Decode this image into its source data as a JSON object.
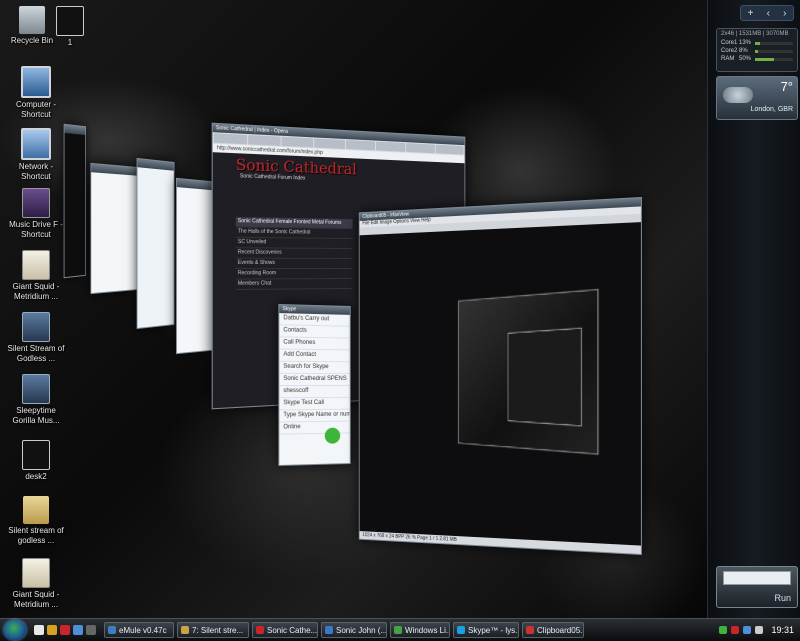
{
  "desktop": {
    "icons": [
      {
        "label": "Recycle Bin"
      },
      {
        "label": "1"
      },
      {
        "label": "Computer - Shortcut"
      },
      {
        "label": "Network - Shortcut"
      },
      {
        "label": "Music Drive F - Shortcut"
      },
      {
        "label": "Giant Squid - Metridium ..."
      },
      {
        "label": "Silent Stream of Godless ..."
      },
      {
        "label": "Sleepytime Gorilla Mus..."
      },
      {
        "label": "desk2"
      },
      {
        "label": "Silent stream of godless ..."
      },
      {
        "label": "Giant Squid - Metridium ..."
      }
    ]
  },
  "sidebar": {
    "top_buttons": [
      "+",
      "‹",
      "›"
    ],
    "cpu": {
      "title": "2x46 | 1531MB | 3070MB",
      "rows": [
        {
          "name": "Core1",
          "value": "13%",
          "level": 0.13
        },
        {
          "name": "Core2",
          "value": "8%",
          "level": 0.08
        },
        {
          "name": "RAM",
          "value": "50%",
          "level": 0.5
        }
      ]
    },
    "weather": {
      "temp": "7°",
      "location": "London, GBR"
    },
    "run": {
      "label": "Run"
    }
  },
  "windows": {
    "opera": {
      "title": "Sonic Cathedral | Index - Opera",
      "address": "http://www.soniccathedral.com/forum/index.php",
      "logo": "Sonic Cathedral",
      "subtitle": "Sonic Cathedral Forum Index",
      "rows": [
        "Sonic Cathedral Female Fronted Metal Forums",
        "The Halls of the Sonic Cathedral",
        "SC Unveiled",
        "Recent Discoveries",
        "Events & Shows",
        "Recording Room",
        "Members Chat"
      ]
    },
    "skype": {
      "title": "Skype",
      "rows": [
        "Datbu's Carry out",
        "Contacts",
        "Call Phones",
        "Add Contact",
        "Search for Skype",
        "Sonic Cathedral SPENS",
        "shesscoff",
        "Skype Test Call",
        "Type Skype Name or number",
        "Online"
      ]
    },
    "irfan": {
      "title": "Clipboard05 - IrfanView",
      "menu": "File Edit Image Options View Help",
      "status": "1024 x 768 x 24 BPP   26 %   Page 1 / 1   2.81 MB"
    },
    "explorer_title": "",
    "mail_title": "",
    "messenger_title": "",
    "aol_title": ""
  },
  "taskbar": {
    "tasks": [
      {
        "label": "eMule v0.47c",
        "color": "#3f7fbf"
      },
      {
        "label": "7: Silent stre...",
        "color": "#caa24a"
      },
      {
        "label": "Sonic Cathe...",
        "color": "#c8262a"
      },
      {
        "label": "Sonic John (...",
        "color": "#3a78c8"
      },
      {
        "label": "Windows Li...",
        "color": "#45a24a"
      },
      {
        "label": "Skype™ - lys...",
        "color": "#1aa0e0"
      },
      {
        "label": "Clipboard05...",
        "color": "#c83232"
      }
    ],
    "clock": "19:31"
  }
}
